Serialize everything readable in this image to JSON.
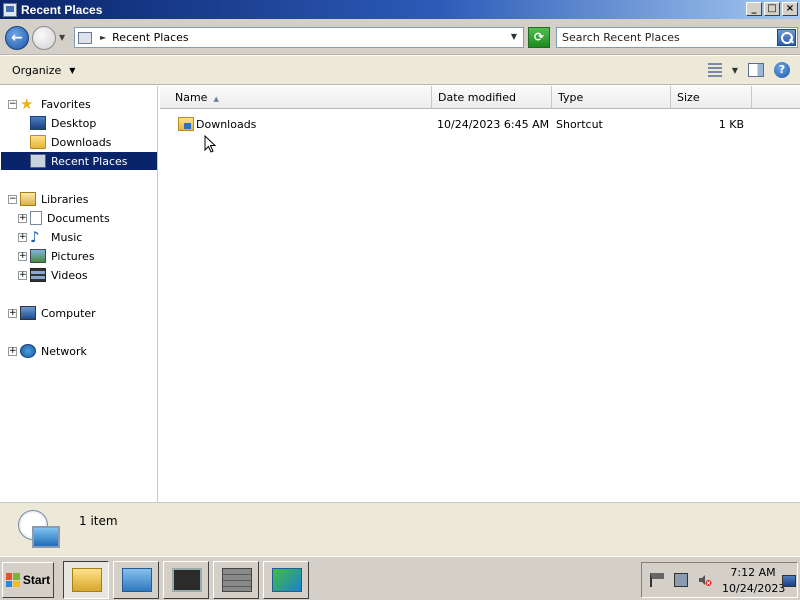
{
  "window": {
    "title": "Recent Places",
    "minimize": "_",
    "maximize": "□",
    "close": "×"
  },
  "address": {
    "location": "Recent Places",
    "search_placeholder": "Search Recent Places"
  },
  "toolbar": {
    "organize": "Organize",
    "help": "?"
  },
  "nav": {
    "favorites": "Favorites",
    "desktop": "Desktop",
    "downloads": "Downloads",
    "recent_places": "Recent Places",
    "libraries": "Libraries",
    "documents": "Documents",
    "music": "Music",
    "pictures": "Pictures",
    "videos": "Videos",
    "computer": "Computer",
    "network": "Network"
  },
  "columns": {
    "name": "Name",
    "date_modified": "Date modified",
    "type": "Type",
    "size": "Size"
  },
  "files": [
    {
      "name": "Downloads",
      "date_modified": "10/24/2023 6:45 AM",
      "type": "Shortcut",
      "size": "1 KB"
    }
  ],
  "details": {
    "count": "1 item"
  },
  "taskbar": {
    "start": "Start",
    "time": "7:12 AM",
    "date": "10/24/2023"
  },
  "icons": {
    "back": "back-arrow-icon",
    "forward": "forward-arrow-icon",
    "refresh": "refresh-icon",
    "search": "search-icon",
    "views": "views-icon",
    "preview_pane": "preview-pane-icon",
    "help": "help-icon"
  }
}
